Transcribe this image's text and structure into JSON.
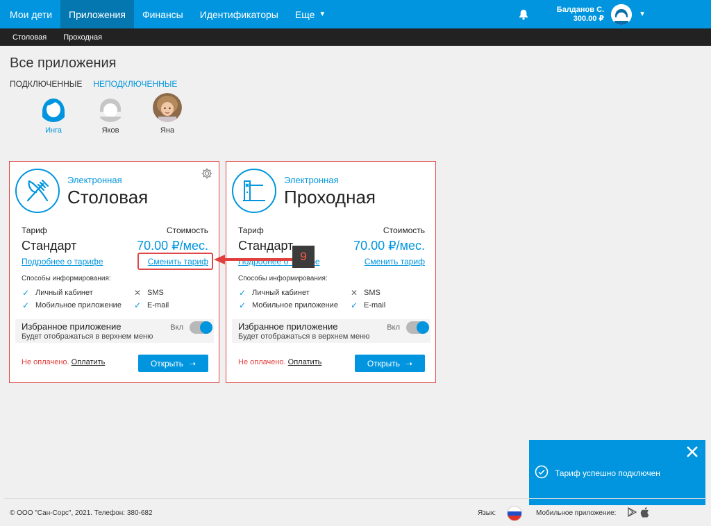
{
  "nav": {
    "items": [
      {
        "label": "Мои дети",
        "active": false
      },
      {
        "label": "Приложения",
        "active": true
      },
      {
        "label": "Финансы",
        "active": false
      },
      {
        "label": "Идентификаторы",
        "active": false
      },
      {
        "label": "Еще",
        "active": false
      }
    ],
    "more_caret": "▼",
    "user_name": "Балданов С.",
    "user_balance": "300.00 ₽",
    "user_caret": "▼"
  },
  "subnav": {
    "items": [
      "Столовая",
      "Проходная"
    ]
  },
  "page": {
    "title": "Все приложения",
    "tabs": [
      {
        "label": "ПОДКЛЮЧЕННЫЕ",
        "active": true
      },
      {
        "label": "НЕПОДКЛЮЧЕННЫЕ",
        "active": false
      }
    ]
  },
  "children": [
    {
      "name": "Инга",
      "selected": true
    },
    {
      "name": "Яков",
      "selected": false
    },
    {
      "name": "Яна",
      "selected": false
    }
  ],
  "cards": [
    {
      "subtitle": "Электронная",
      "title": "Столовая",
      "tariff_label": "Тариф",
      "cost_label": "Стоимость",
      "plan": "Стандарт",
      "price": "70.00 ₽/мес.",
      "details_link": "Подробнее о тарифе",
      "change_link": "Сменить тариф",
      "info_heading": "Способы информирования:",
      "options": [
        {
          "label": "Личный кабинет",
          "enabled": true
        },
        {
          "label": "SMS",
          "enabled": false
        },
        {
          "label": "Мобильное приложение",
          "enabled": true
        },
        {
          "label": "E-mail",
          "enabled": true
        }
      ],
      "fav_title": "Избранное приложение",
      "fav_desc": "Будет отображаться в верхнем меню",
      "fav_state": "Вкл",
      "unpaid": "Не оплачено.",
      "pay": "Оплатить",
      "open": "Открыть"
    },
    {
      "subtitle": "Электронная",
      "title": "Проходная",
      "tariff_label": "Тариф",
      "cost_label": "Стоимость",
      "plan": "Стандарт",
      "price": "70.00 ₽/мес.",
      "details_link": "Подробнее о тарифе",
      "change_link": "Сменить тариф",
      "info_heading": "Способы информирования:",
      "options": [
        {
          "label": "Личный кабинет",
          "enabled": true
        },
        {
          "label": "SMS",
          "enabled": false
        },
        {
          "label": "Мобильное приложение",
          "enabled": true
        },
        {
          "label": "E-mail",
          "enabled": true
        }
      ],
      "fav_title": "Избранное приложение",
      "fav_desc": "Будет отображаться в верхнем меню",
      "fav_state": "Вкл",
      "unpaid": "Не оплачено.",
      "pay": "Оплатить",
      "open": "Открыть"
    }
  ],
  "step_badge": "9",
  "toast": {
    "message": "Тариф успешно подключен"
  },
  "footer": {
    "copyright": "© ООО \"Сан-Сорс\", 2021. Телефон: 380-682",
    "language_label": "Язык:",
    "mobile_label": "Мобильное приложение:"
  },
  "colors": {
    "accent": "#0095de",
    "nav_active": "#0477b0",
    "error": "#e0413e",
    "card_border": "#e04848"
  }
}
